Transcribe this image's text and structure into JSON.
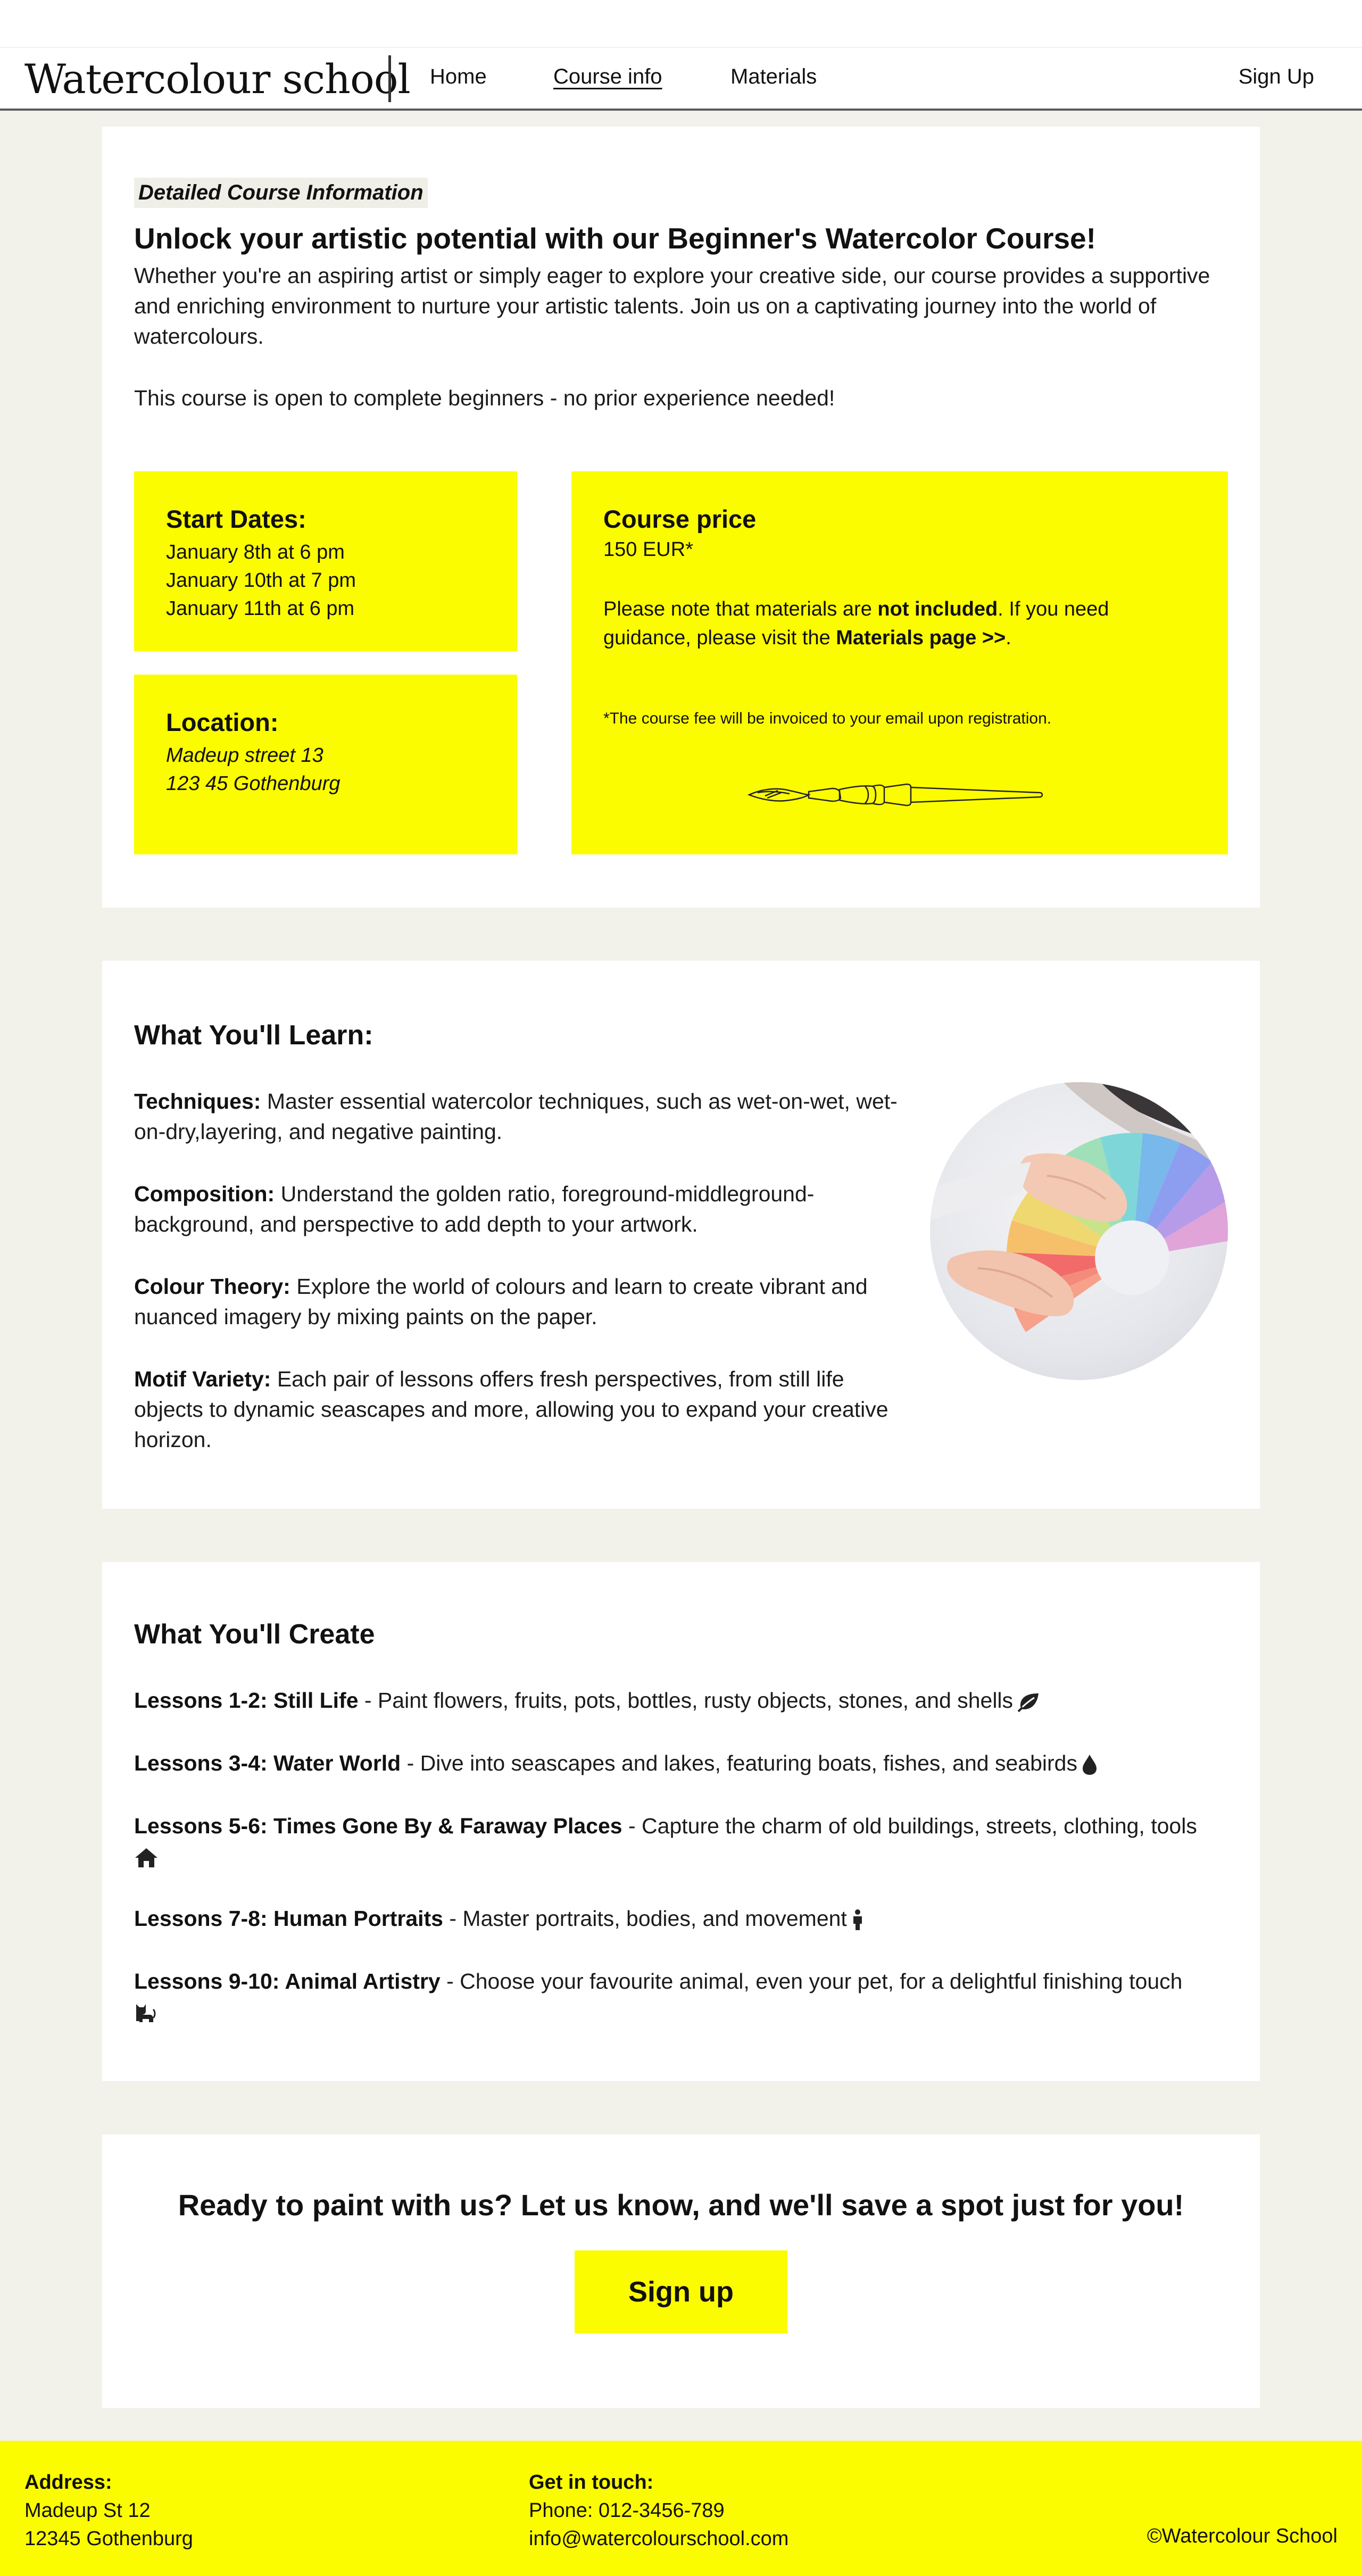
{
  "nav": {
    "logo": "Watercolour school",
    "home": "Home",
    "course_info": "Course info",
    "materials": "Materials",
    "signup": "Sign Up"
  },
  "course": {
    "eyebrow": "Detailed Course Information",
    "heading": "Unlock your artistic potential with our Beginner's Watercolor Course!",
    "intro": "Whether you're an aspiring artist or simply eager to explore your creative side, our course provides a supportive and enriching environment to nurture your artistic talents. Join us on a captivating journey into the world of watercolours.",
    "beginners": "This course is open to complete beginners - no prior experience needed!",
    "dates": {
      "title": "Start Dates:",
      "lines": [
        "January 8th at 6 pm",
        "January 10th at 7 pm",
        "January 11th at 6 pm"
      ]
    },
    "location": {
      "title": "Location:",
      "lines": [
        "Madeup street 13",
        "123 45 Gothenburg"
      ]
    },
    "price": {
      "title": "Course price",
      "value": "150 EUR*",
      "note_a": "Please note that materials are ",
      "note_b": "not included",
      "note_c": ". If you need guidance, please visit the ",
      "note_link": "Materials page >>",
      "note_d": ".",
      "small": "*The course fee will be invoiced to your email upon registration."
    },
    "icons": {
      "brush": "paintbrush-icon"
    }
  },
  "learn": {
    "title": "What You'll Learn:",
    "items": [
      {
        "label": "Techniques:",
        "text": " Master essential watercolor techniques, such as wet-on-wet, wet-on-dry,layering, and negative painting."
      },
      {
        "label": "Composition:",
        "text": " Understand the golden ratio, foreground-middleground-background, and perspective to add depth to your artwork."
      },
      {
        "label": "Colour Theory:",
        "text": " Explore the world of colours and learn to create vibrant and nuanced imagery by mixing paints on the paper."
      },
      {
        "label": "Motif Variety:",
        "text": " Each pair of lessons offers fresh perspectives, from still life objects to dynamic seascapes and more, allowing you to expand your creative horizon."
      }
    ]
  },
  "create": {
    "title": "What You'll Create",
    "items": [
      {
        "label": "Lessons 1-2: Still Life",
        "text": " - Paint flowers, fruits, pots, bottles, rusty objects, stones, and shells",
        "icon": "leaf-icon"
      },
      {
        "label": "Lessons 3-4: Water World",
        "text": " - Dive into seascapes and lakes, featuring boats, fishes, and seabirds",
        "icon": "droplet-icon"
      },
      {
        "label": "Lessons 5-6: Times Gone By & Faraway Places",
        "text": " - Capture the charm of old buildings, streets, clothing, tools",
        "icon": "house-icon"
      },
      {
        "label": "Lessons 7-8: Human Portraits",
        "text": " - Master portraits, bodies, and movement",
        "icon": "person-icon"
      },
      {
        "label": "Lessons 9-10: Animal Artistry",
        "text": " - Choose your favourite animal, even your pet, for a delightful finishing touch",
        "icon": "cat-icon"
      }
    ]
  },
  "cta": {
    "text": "Ready to paint with us? Let us know, and we'll save a spot just for you!",
    "button": "Sign up"
  },
  "footer": {
    "address_title": "Address:",
    "address_lines": [
      "Madeup St 12",
      "12345 Gothenburg"
    ],
    "contact_title": "Get in touch:",
    "phone": "Phone: 012-3456-789",
    "email": "info@watercolourschool.com",
    "copyright": "©Watercolour School"
  },
  "colors": {
    "accent_yellow": "#fcfc00",
    "page_bg": "#f2f1ea",
    "card_bg": "#ffffff",
    "text": "#111111"
  }
}
